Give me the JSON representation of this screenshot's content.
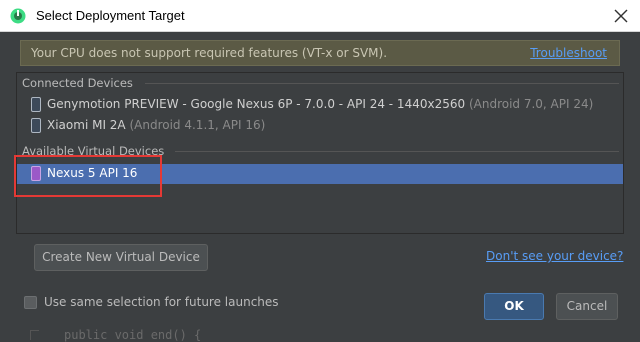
{
  "window": {
    "title": "Select Deployment Target",
    "app_icon": "android-studio-icon",
    "close_icon": "close-icon"
  },
  "warning": {
    "message": "Your CPU does not support required features (VT-x or SVM).",
    "link_label": "Troubleshoot"
  },
  "connected": {
    "label": "Connected Devices",
    "devices": [
      {
        "name": "Genymotion PREVIEW - Google Nexus 6P - 7.0.0 - API 24 - 1440x2560",
        "sub": "(Android 7.0, API 24)",
        "icon": "phone-icon"
      },
      {
        "name": "Xiaomi MI 2A",
        "sub": "(Android 4.1.1, API 16)",
        "icon": "phone-icon"
      }
    ]
  },
  "virtual": {
    "label": "Available Virtual Devices",
    "devices": [
      {
        "name": "Nexus 5 API 16",
        "selected": true,
        "icon": "avd-phone-icon"
      }
    ]
  },
  "actions": {
    "create_label": "Create New Virtual Device",
    "dont_see_label": "Don't see your device?",
    "ok_label": "OK",
    "cancel_label": "Cancel"
  },
  "options": {
    "reuse_label": "Use same selection for future launches",
    "reuse_checked": false
  },
  "background": {
    "code_snippet": "public void end() {"
  },
  "colors": {
    "dialog_bg": "#3c3f41",
    "selection": "#4b6eaf",
    "link": "#589df6",
    "warning_bg": "#5b5a45",
    "annotation_red": "#e53935"
  }
}
